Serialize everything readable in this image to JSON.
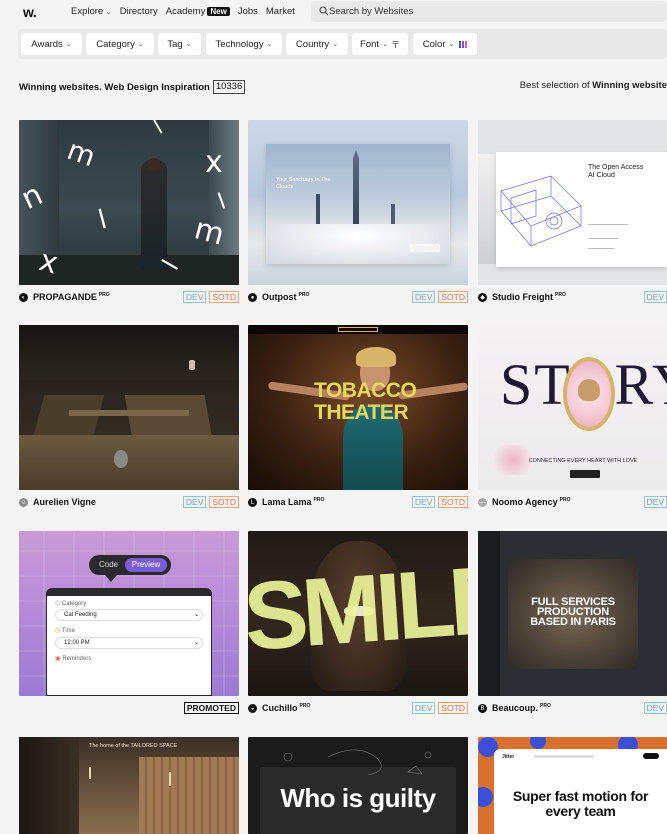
{
  "nav": {
    "logo": "w.",
    "links": [
      "Explore",
      "Directory",
      "Academy",
      "Jobs",
      "Market"
    ],
    "new_badge": "New",
    "search_placeholder": "Search by Websites"
  },
  "filters": [
    "Awards",
    "Category",
    "Tag",
    "Technology",
    "Country",
    "Font",
    "Color"
  ],
  "header": {
    "headline": "Winning websites. Web Design Inspiration",
    "count": "10336",
    "right_prefix": "Best selection of",
    "right_bold": "Winning website"
  },
  "colors": {
    "dev": "#6fa0c8",
    "sotd": "#e0774a",
    "preview_purple": "#7a5cd6"
  },
  "cards": [
    {
      "name": "PROPAGANDE",
      "pro": "PRO",
      "dev": "DEV",
      "sotd": "SOTD",
      "icon": "propagande-logo-icon"
    },
    {
      "name": "Outpost",
      "pro": "PRO",
      "dev": "DEV",
      "sotd": "SOTD",
      "icon": "outpost-logo-icon",
      "thumb_title": "Your Sanctuary In The Clouds"
    },
    {
      "name": "Studio Freight",
      "pro": "PRO",
      "dev": "DEV",
      "icon": "studio-freight-logo-icon",
      "thumb_title": "The Open Access AI Cloud"
    },
    {
      "name": "Aurelien Vigne",
      "dev": "DEV",
      "sotd": "SOTD",
      "icon": "avatar-icon"
    },
    {
      "name": "Lama Lama",
      "pro": "PRO",
      "dev": "DEV",
      "sotd": "SOTD",
      "icon": "lama-lama-logo-icon",
      "thumb_title": "TOBACCO THEATER"
    },
    {
      "name": "Noomo Agency",
      "pro": "PRO",
      "dev": "DEV",
      "icon": "noomo-logo-icon",
      "thumb_title": "STORY",
      "thumb_sub": "CONNECTING EVERY HEART WITH LOVE"
    },
    {
      "promoted": "PROMOTED",
      "thumb_tabs": [
        "Code",
        "Preview"
      ],
      "thumb_fields": [
        "Category",
        "Cat Feeding",
        "Time",
        "12:00 PM",
        "Reminders"
      ]
    },
    {
      "name": "Cuchillo",
      "pro": "PRO",
      "dev": "DEV",
      "sotd": "SOTD",
      "icon": "cuchillo-logo-icon",
      "thumb_title": "SMILE"
    },
    {
      "name": "Beaucoup.",
      "pro": "PRO",
      "dev": "DEV",
      "icon": "beaucoup-logo-icon",
      "thumb_title": "FULL SERVICES PRODUCTION BASED IN PARIS"
    },
    {
      "thumb_title": "The home of the TAILORED SPACE"
    },
    {
      "thumb_title": "Who is guilty"
    },
    {
      "thumb_title": "Super fast motion for every team"
    }
  ]
}
